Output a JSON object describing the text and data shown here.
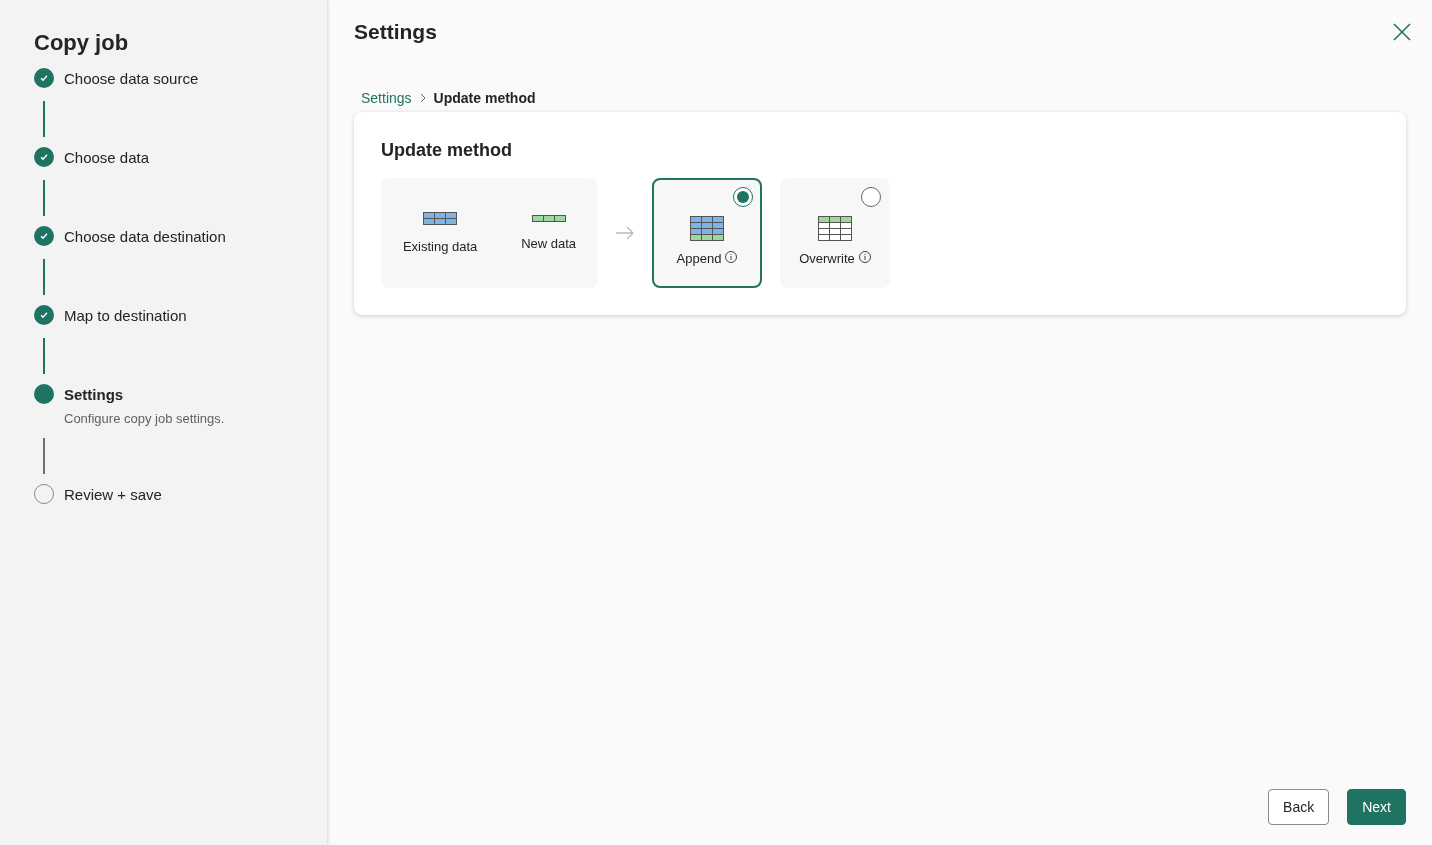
{
  "sidebar": {
    "title": "Copy job",
    "steps": [
      {
        "label": "Choose data source",
        "checked": true,
        "selected": false
      },
      {
        "label": "Choose data",
        "checked": true,
        "selected": false
      },
      {
        "label": "Choose data destination",
        "checked": true,
        "selected": false
      },
      {
        "label": "Map to destination",
        "checked": true,
        "selected": false
      },
      {
        "label": "Settings",
        "checked": false,
        "selected": true,
        "description": "Configure copy job settings."
      },
      {
        "label": "Review + save",
        "checked": false,
        "selected": false
      }
    ]
  },
  "header": {
    "title": "Settings"
  },
  "breadcrumb": [
    {
      "label": "Settings",
      "selected": false
    },
    {
      "label": "Update method",
      "selected": true
    }
  ],
  "card": {
    "title": "Update method",
    "legend": [
      {
        "label": "Existing data"
      },
      {
        "label": "New data"
      }
    ],
    "options": [
      {
        "label": "Append",
        "selected": true
      },
      {
        "label": "Overwrite",
        "selected": false
      }
    ]
  },
  "footer": {
    "buttons": [
      {
        "label": "Back",
        "kind": "secondary"
      },
      {
        "label": "Next",
        "kind": "primary"
      }
    ]
  }
}
